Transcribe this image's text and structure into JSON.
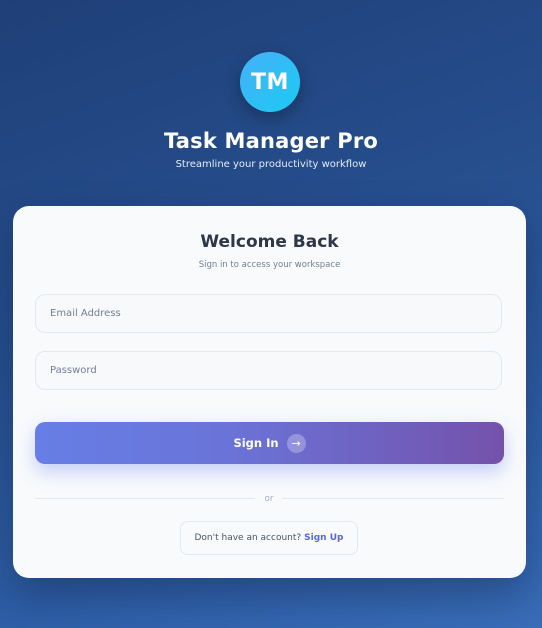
{
  "header": {
    "logo_text": "TM",
    "app_title": "Task Manager Pro",
    "app_subtitle": "Streamline your productivity workflow"
  },
  "login_card": {
    "title": "Welcome Back",
    "subtitle": "Sign in to access your workspace",
    "email": {
      "placeholder": "Email Address",
      "value": ""
    },
    "password": {
      "placeholder": "Password",
      "value": ""
    },
    "signin_button": {
      "label": "Sign In",
      "icon": "arrow-right-icon",
      "icon_glyph": "→"
    },
    "divider_text": "or",
    "signup": {
      "prompt": "Don't have an account?",
      "link_label": "Sign Up"
    }
  },
  "colors": {
    "background_start": "#1f3f78",
    "background_end": "#3a6db8",
    "logo_gradient_start": "#45b0f8",
    "logo_gradient_end": "#1bcbf2",
    "button_gradient_start": "#667ee6",
    "button_gradient_end": "#7452ac",
    "link": "#5a67d8",
    "card_background": "#f8fafc"
  }
}
